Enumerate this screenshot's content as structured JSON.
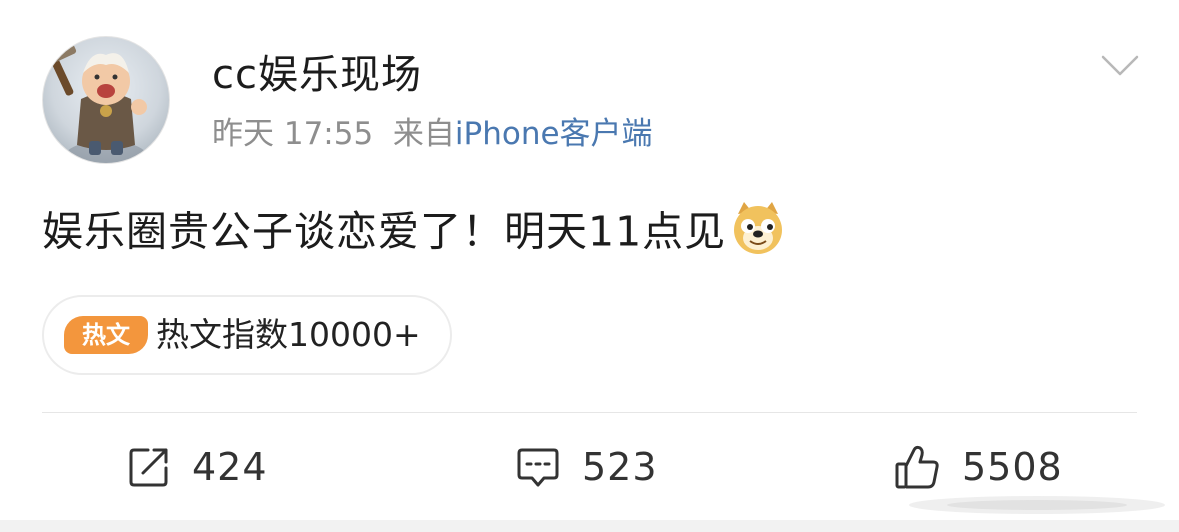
{
  "post": {
    "username": "cc娱乐现场",
    "time": "昨天 17:55",
    "source_prefix": "来自",
    "source": "iPhone客户端",
    "text": "娱乐圈贵公子谈恋爱了！明天11点见",
    "emoji_icon": "doge-emoji-icon"
  },
  "hot": {
    "badge": "热文",
    "label": "热文指数10000+"
  },
  "actions": {
    "repost_count": "424",
    "comment_count": "523",
    "like_count": "5508"
  },
  "colors": {
    "source_link": "#4a78b0",
    "hot_badge": "#f3963d",
    "meta_gray": "#8e8e8e"
  }
}
